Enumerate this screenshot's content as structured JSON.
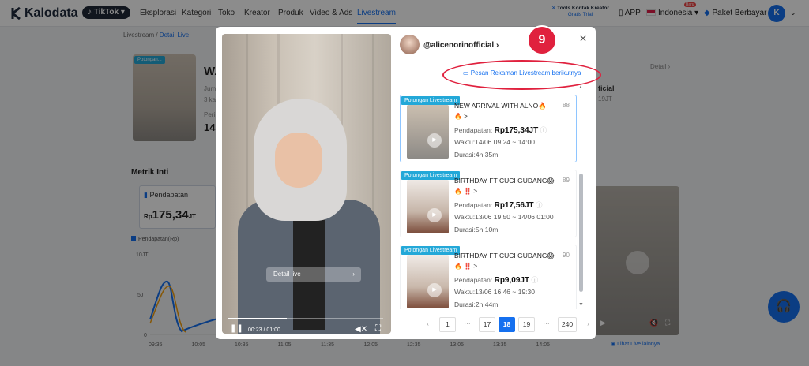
{
  "nav": {
    "brand": "Kalodata",
    "platform": "TikTok",
    "items": [
      "Eksplorasi",
      "Kategori",
      "Toko",
      "Kreator",
      "Produk",
      "Video & Ads",
      "Livestream"
    ],
    "active": "Livestream",
    "tools_title": "Tools Kontak Kreator",
    "tools_sub": "Gratis Trial",
    "app": "APP",
    "language": "Indonesia",
    "new_badge": "Baru",
    "plan": "Paket Berbayar",
    "avatar_letter": "K"
  },
  "background": {
    "breadcrumb_root": "Livestream",
    "breadcrumb_current": "Detail Live",
    "thumb_tag": "Potongan...",
    "title_fragment": "WA",
    "meta1": "Jum",
    "meta2": "3 ka",
    "meta3": "Peri",
    "big_value": "14,",
    "detail_link": "Detail",
    "right_fragment1": "ficial",
    "right_fragment2": "19JT",
    "metrik_title": "Metrik Inti",
    "card_label": "Pendapatan",
    "card_prefix": "Rp",
    "card_value": "175,34",
    "card_unit": "JT",
    "legend": "Pendapatan(Rp)",
    "lihat_live": "Lihat Live lainnya",
    "chart_y_labels": [
      "10JT",
      "5JT",
      "0"
    ],
    "chart_x_labels": [
      "09:35",
      "10:05",
      "10:35",
      "11:05",
      "11:35",
      "12:05",
      "12:35",
      "13:05",
      "13:35",
      "14:05"
    ]
  },
  "modal": {
    "host": "@alicenorinofficial",
    "badge_number": "9",
    "record_link": "Pesan Rekaman Livestream berikutnya",
    "video": {
      "detail_live": "Detail live",
      "time": "00:23 / 01:00",
      "progress": 0.38
    },
    "items": [
      {
        "tag": "Potongan Livestream",
        "title": "NEW ARRIVAL WITH ALNO🔥",
        "count": "88",
        "emojis": "🔥 >",
        "revenue_label": "Pendapatan:",
        "revenue": "Rp175,34JT",
        "time": "Waktu:14/06 09:24 ~ 14:00",
        "duration": "Durasi:4h 35m",
        "selected": true
      },
      {
        "tag": "Potongan Livestream",
        "title": "BIRTHDAY FT CUCI GUDANG😱",
        "count": "89",
        "emojis": "🔥 ‼️ >",
        "revenue_label": "Pendapatan:",
        "revenue": "Rp17,56JT",
        "time": "Waktu:13/06 19:50 ~ 14/06 01:00",
        "duration": "Durasi:5h 10m",
        "selected": false
      },
      {
        "tag": "Potongan Livestream",
        "title": "BIRTHDAY FT CUCI GUDANG😱",
        "count": "90",
        "emojis": "🔥 ‼️ >",
        "revenue_label": "Pendapatan:",
        "revenue": "Rp9,09JT",
        "time": "Waktu:13/06 16:46 ~ 19:30",
        "duration": "Durasi:2h 44m",
        "selected": false
      }
    ],
    "pagination": {
      "pages": [
        "1",
        "···",
        "17",
        "18",
        "19",
        "···",
        "240"
      ],
      "current": "18"
    }
  },
  "colors": {
    "primary": "#1570ef",
    "annotation": "#e0213e",
    "tag": "#23a8d8"
  }
}
